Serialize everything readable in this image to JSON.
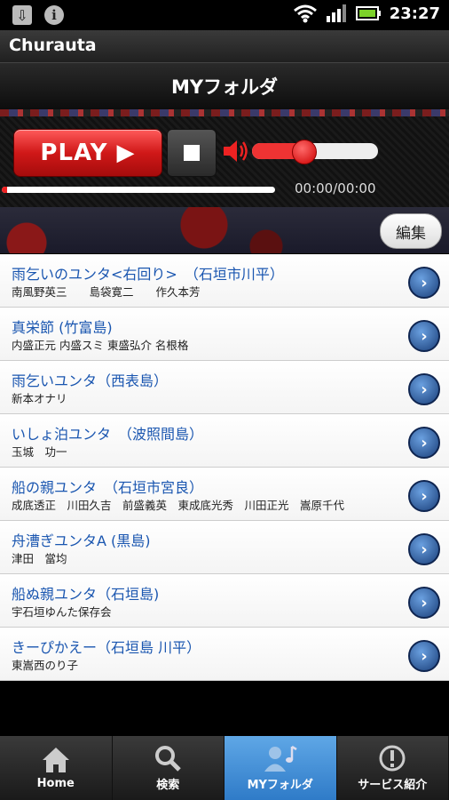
{
  "status_bar": {
    "time": "23:27"
  },
  "app": {
    "title": "Churauta"
  },
  "header": {
    "title": "MYフォルダ"
  },
  "player": {
    "play_label": "PLAY ▶",
    "time": "00:00/00:00",
    "volume_fraction": 0.41,
    "progress_fraction": 0.02
  },
  "edit_label": "編集",
  "songs": [
    {
      "title": "雨乞いのユンタ<右回り>　（石垣市川平）",
      "artist": "南風野英三　　島袋寛二　　作久本芳"
    },
    {
      "title": "真栄節 (竹富島)",
      "artist": "内盛正元 内盛スミ 東盛弘介 名根格"
    },
    {
      "title": "雨乞いユンタ（西表島）",
      "artist": "新本オナリ"
    },
    {
      "title": "いしょ泊ユンタ　（波照間島）",
      "artist": "玉城　功一"
    },
    {
      "title": "船の親ユンタ　（石垣市宮良）",
      "artist": "成底透正　川田久吉　前盛義英　東成底光秀　川田正光　嵩原千代"
    },
    {
      "title": "舟漕ぎユンタA (黒島)",
      "artist": "津田　當均"
    },
    {
      "title": "船ぬ親ユンタ（石垣島)",
      "artist": "宇石垣ゆんた保存会"
    },
    {
      "title": "きーぴかえー（石垣島 川平）",
      "artist": "東嵩西のり子"
    }
  ],
  "tabs": [
    {
      "label": "Home",
      "icon": "home-icon"
    },
    {
      "label": "検索",
      "icon": "search-icon"
    },
    {
      "label": "MYフォルダ",
      "icon": "my-folder-icon"
    },
    {
      "label": "サービス紹介",
      "icon": "info-icon"
    }
  ],
  "colors": {
    "accent": "#e22222",
    "link": "#1a56b0",
    "active_tab": "#4a94d8"
  }
}
